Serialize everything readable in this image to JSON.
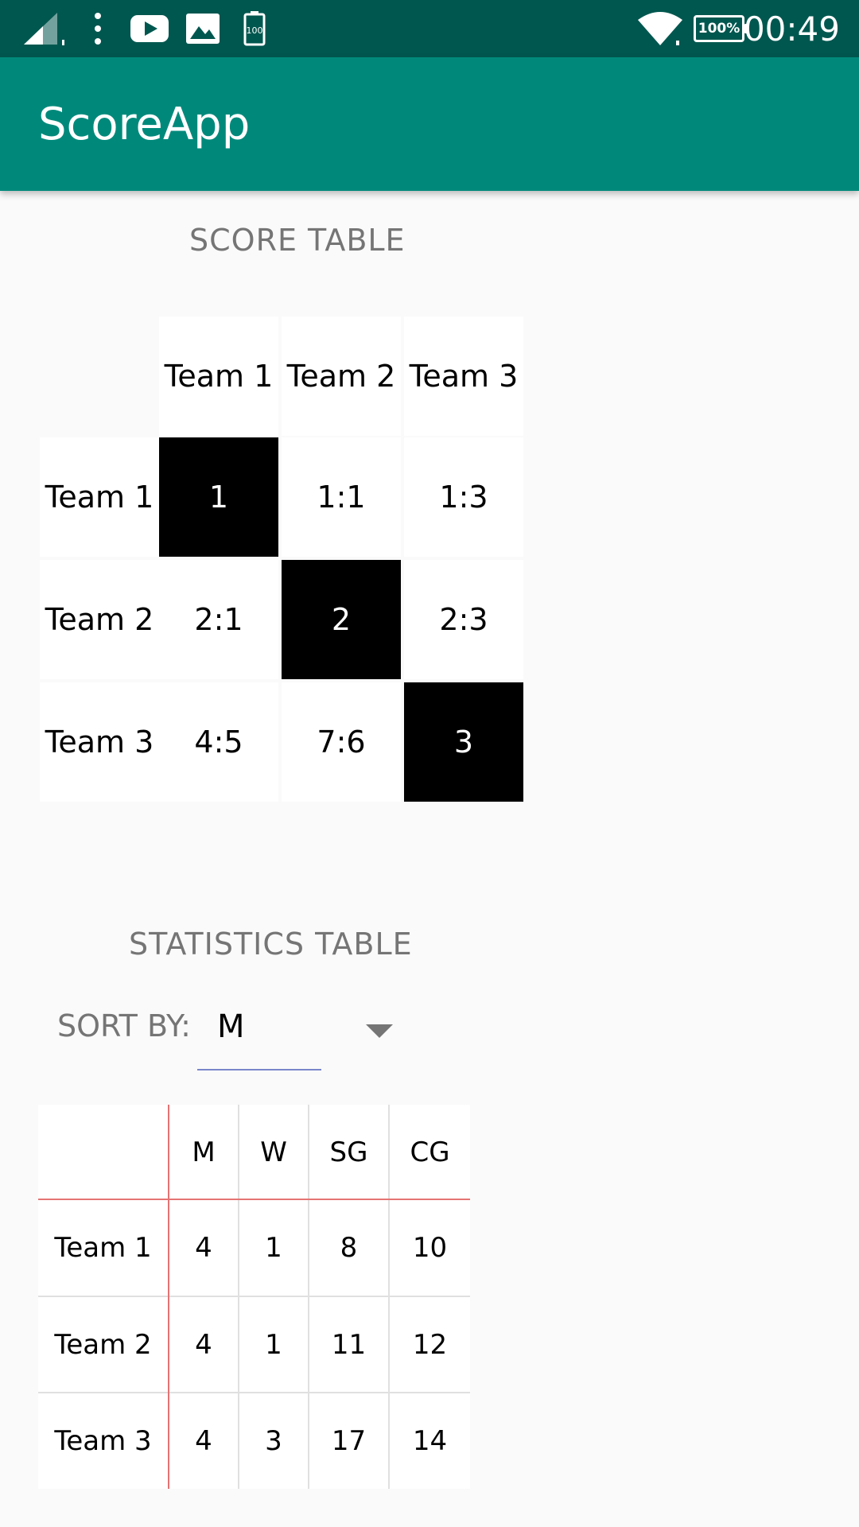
{
  "status_bar": {
    "time": "00:49",
    "battery": "100%",
    "icons": [
      "signal-icon",
      "more-vert-icon",
      "youtube-icon",
      "image-icon",
      "battery-small-icon",
      "wifi-icon",
      "battery-icon"
    ]
  },
  "app_bar": {
    "title": "ScoreApp"
  },
  "score_table": {
    "title": "SCORE TABLE",
    "columns": [
      "Team 1",
      "Team 2",
      "Team 3"
    ],
    "rows": [
      {
        "label": "Team 1",
        "cells": [
          "1",
          "1:1",
          "1:3"
        ]
      },
      {
        "label": "Team 2",
        "cells": [
          "2:1",
          "2",
          "2:3"
        ]
      },
      {
        "label": "Team 3",
        "cells": [
          "4:5",
          "7:6",
          "3"
        ]
      }
    ]
  },
  "statistics": {
    "title": "STATISTICS TABLE",
    "sort_label": "SORT BY:",
    "sort_value": "M",
    "columns": [
      "M",
      "W",
      "SG",
      "CG"
    ],
    "rows": [
      {
        "label": "Team 1",
        "values": [
          "4",
          "1",
          "8",
          "10"
        ]
      },
      {
        "label": "Team 2",
        "values": [
          "4",
          "1",
          "11",
          "12"
        ]
      },
      {
        "label": "Team 3",
        "values": [
          "4",
          "3",
          "17",
          "14"
        ]
      }
    ]
  },
  "colors": {
    "status_bar": "#00574f",
    "app_bar": "#00897b",
    "diagonal_cell": "#000000",
    "divider_accent": "#e57373",
    "spinner_underline": "#7986cb"
  }
}
